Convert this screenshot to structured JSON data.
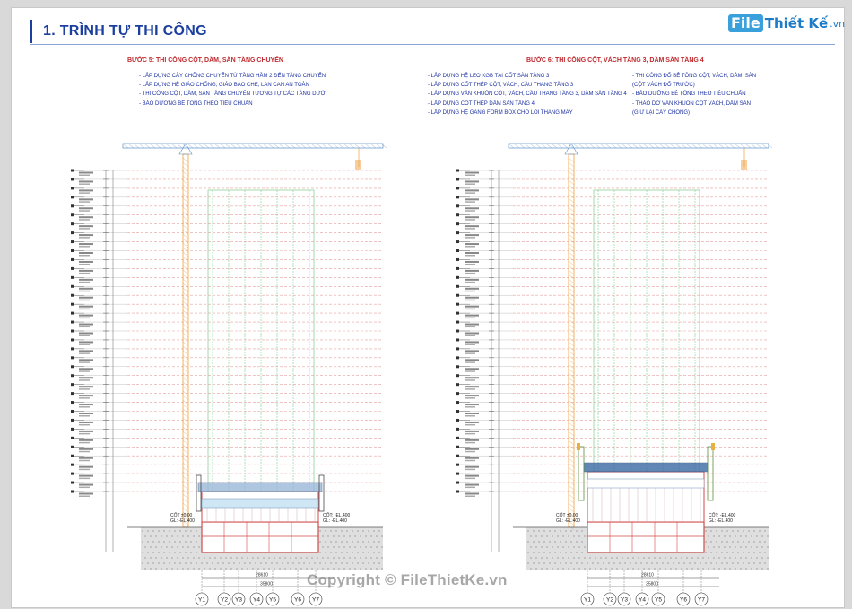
{
  "header": {
    "title": "1. TRÌNH TỰ THI CÔNG",
    "logo": {
      "brand_box": "File",
      "brand_rest": "Thiết Kế",
      "domain": ".vn"
    }
  },
  "steps": [
    {
      "title": "BƯỚC 5: THI CÔNG CỘT, DẦM, SÀN TẦNG CHUYỂN",
      "bullets_left": [
        "- LẮP DỰNG CÂY CHỐNG CHUYỂN TỪ TẦNG HẦM 2 ĐẾN TẦNG CHUYỂN",
        "- LẮP DỰNG HỆ GIÁO CHỐNG, GIÁO BAO CHE, LAN CAN AN TOÀN",
        "- THI CÔNG CỘT, DẦM, SÀN TẦNG CHUYỂN TƯƠNG TỰ CÁC TẦNG DƯỚI",
        "- BẢO DƯỠNG BÊ TÔNG THEO TIÊU CHUẨN"
      ],
      "bullets_right": [],
      "level_left": [
        "CỐT ±0.00",
        "GL: -EL.400"
      ],
      "level_right": [
        "CỐT: -EL.400",
        "GL: -EL.400"
      ],
      "dims_top": "28610",
      "dims_bottom": "35800",
      "axes": [
        "Y1",
        "Y2",
        "Y3",
        "Y4",
        "Y5",
        "Y6",
        "Y7"
      ]
    },
    {
      "title": "BƯỚC 6: THI CÔNG CỘT, VÁCH TẦNG 3, DẦM SÀN TẦNG 4",
      "bullets_left": [
        "- LẮP DỰNG HỆ LEO KGB TẠI CỐT SÀN TẦNG 3",
        "- LẮP DỰNG CỐT THÉP CỘT, VÁCH, CẦU THANG TẦNG 3",
        "- LẮP DỰNG VÁN KHUÔN CỘT, VÁCH, CẦU THANG TẦNG 3, DẦM SÀN TẦNG 4",
        "- LẮP DỰNG CỐT THÉP DẦM SÀN TẦNG 4",
        "- LẮP DỰNG HỆ GANG FORM BOX CHO LÕI THANG MÁY"
      ],
      "bullets_right": [
        "- THI CÔNG ĐỔ BÊ TÔNG CỘT, VÁCH, DẦM, SÀN",
        "(CỘT VÁCH ĐỔ TRƯỚC)",
        "- BẢO DƯỠNG BÊ TÔNG THEO TIÊU CHUẨN",
        "- THÁO DỠ VÁN KHUÔN CỘT VÁCH, DẦM SÀN",
        "(GIỮ LẠI CÂY CHỐNG)"
      ],
      "level_left": [
        "CỐT ±0.00",
        "GL: -EL.400"
      ],
      "level_right": [
        "CỐT: -EL.400",
        "GL: -EL.400"
      ],
      "dims_top": "28610",
      "dims_bottom": "35800",
      "axes": [
        "Y1",
        "Y2",
        "Y3",
        "Y4",
        "Y5",
        "Y6",
        "Y7"
      ]
    }
  ],
  "watermark": "Copyright © FileThietKe.vn",
  "colors": {
    "title": "#1b3f9e",
    "step_title": "#c0282d",
    "bullet_text": "#1b2fa0",
    "crane": "#5b8fc7",
    "mast": "#f0a040",
    "floor_lines": "#e8a0a0",
    "green_frame": "#6ac47a",
    "basement": "#d24a4a",
    "soil": "#b8b8b8"
  }
}
